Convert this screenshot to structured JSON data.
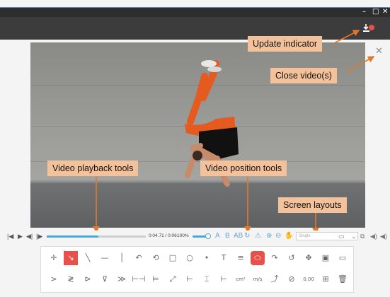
{
  "window": {
    "minimize_glyph": "–",
    "maximize_glyph": "□",
    "close_glyph": "✕"
  },
  "callouts": {
    "update_indicator": "Update indicator",
    "close_videos": "Close video(s)",
    "playback_tools": "Video playback tools",
    "position_tools": "Video position tools",
    "screen_layouts": "Screen layouts"
  },
  "playback": {
    "first_glyph": "|◀",
    "play_glyph": "▶",
    "prev_frame_glyph": "◀|",
    "next_frame_glyph": "|▶",
    "timecode": "0:04.71 / 0:06",
    "zoom": "100%",
    "progress_fraction": 0.52
  },
  "position_tools": [
    "A",
    "B",
    "AB",
    "↻",
    "⚠",
    "⊕",
    "⊖",
    "✋"
  ],
  "layout": {
    "selected": "Single"
  },
  "right_tools": [
    "▭",
    "⌄",
    "⧉",
    "◀)",
    "◀)"
  ],
  "close_video_glyph": "✕",
  "tool_rows": [
    [
      "✛",
      "↘",
      "╲",
      "—",
      "│",
      "↶",
      "⟲",
      "□",
      "○",
      "•",
      "T",
      "≡",
      "⬭",
      "↷",
      "↺",
      "✥",
      "▣",
      "▭"
    ],
    [
      ">",
      "≷",
      "⊳",
      "⊽",
      "≫",
      "⊢⊣",
      "⊨",
      "⤢",
      "⊢",
      "⌶",
      "⊢",
      "cm²",
      "m/s",
      "⤴",
      "⊘",
      "0.00",
      "⊞",
      "🗑"
    ]
  ],
  "colors": {
    "accent": "#e8514a",
    "callout_bg": "#f3c29a",
    "arrow": "#e07a2a",
    "progress": "#4aa7d8"
  }
}
